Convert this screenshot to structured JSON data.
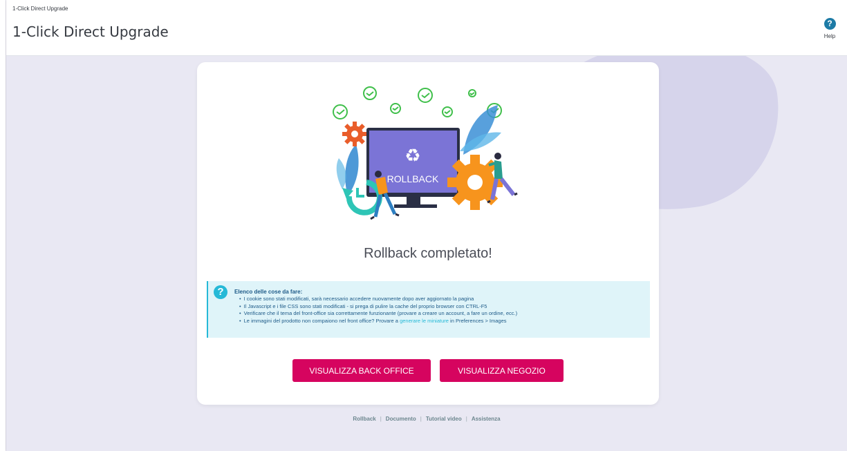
{
  "header": {
    "breadcrumb": "1-Click Direct Upgrade",
    "title": "1-Click Direct Upgrade",
    "help_label": "Help",
    "help_icon": "?"
  },
  "card": {
    "illustration_label": "ROLLBACK",
    "title": "Rollback completato!",
    "todo": {
      "icon": "?",
      "title": "Elenco delle cose da fare:",
      "items": [
        "I cookie sono stati modificati, sarà necessario accedere nuovamente dopo aver aggiornato la pagina",
        "Il Javascript e i file CSS sono stati modificati - si prega di pulire la cache del proprio browser con CTRL-F5",
        "Verificare che il tema del front-office sia correttamente funzionante (provare a creare un account, a fare un ordine, ecc.)"
      ],
      "last_item_prefix": "Le immagini del prodotto non compaiono nel front office? Provare a ",
      "last_item_link": "generare le miniature",
      "last_item_suffix": " in Preferences > Images"
    },
    "buttons": {
      "back_office": "VISUALIZZA BACK OFFICE",
      "shop": "VISUALIZZA NEGOZIO"
    }
  },
  "footer": {
    "links": [
      "Rollback",
      "Documento",
      "Tutorial video",
      "Assistenza"
    ],
    "separator": "|"
  },
  "colors": {
    "accent": "#d6045f",
    "info": "#25b9d7",
    "background": "#e9e8f3"
  }
}
